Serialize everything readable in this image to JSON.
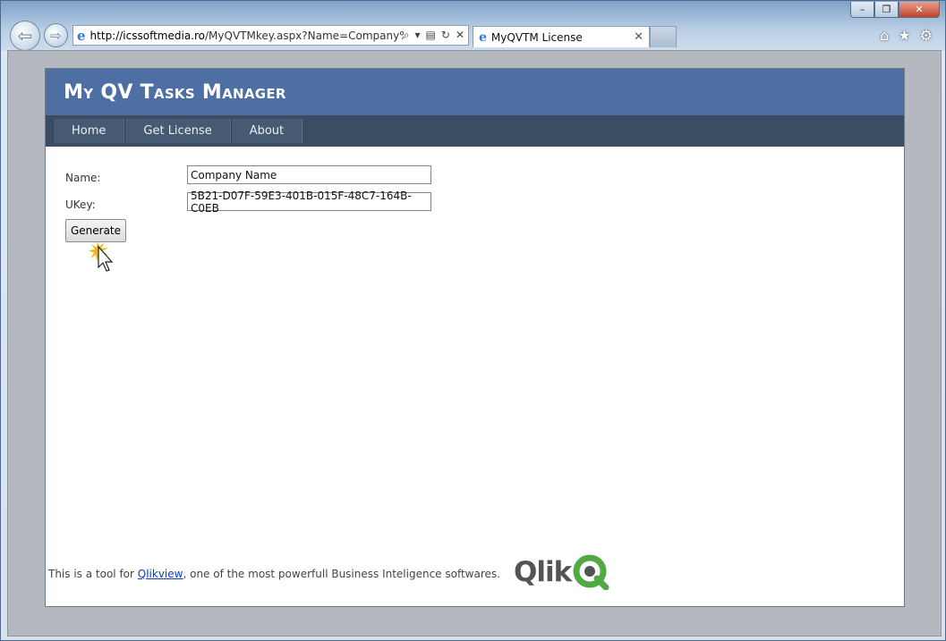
{
  "browser": {
    "url_host": "http://icssoftmedia.ro",
    "url_path": "/MyQVTMkey.aspx?Name=Company%2(",
    "tab_title": "MyQVTM License",
    "window_controls": {
      "minimize": "–",
      "maximize": "❐",
      "close": "✕"
    }
  },
  "page": {
    "site_title": "My QV Tasks Manager",
    "nav": [
      {
        "label": "Home"
      },
      {
        "label": "Get License"
      },
      {
        "label": "About"
      }
    ],
    "form": {
      "name_label": "Name:",
      "name_value": "Company Name",
      "ukey_label": "UKey:",
      "ukey_value": "5B21-D07F-59E3-401B-015F-48C7-164B-C0EB",
      "generate_label": "Generate"
    },
    "footer": {
      "prefix": "This is a tool for ",
      "link_text": "Qlikview",
      "suffix": ", one of the most powerfull Business Inteligence softwares."
    },
    "logo_text": "Qlik"
  },
  "colors": {
    "header": "#4d6fa3",
    "navbar": "#3a4d63",
    "qlik_green": "#52a843",
    "qlik_gray": "#545454"
  }
}
